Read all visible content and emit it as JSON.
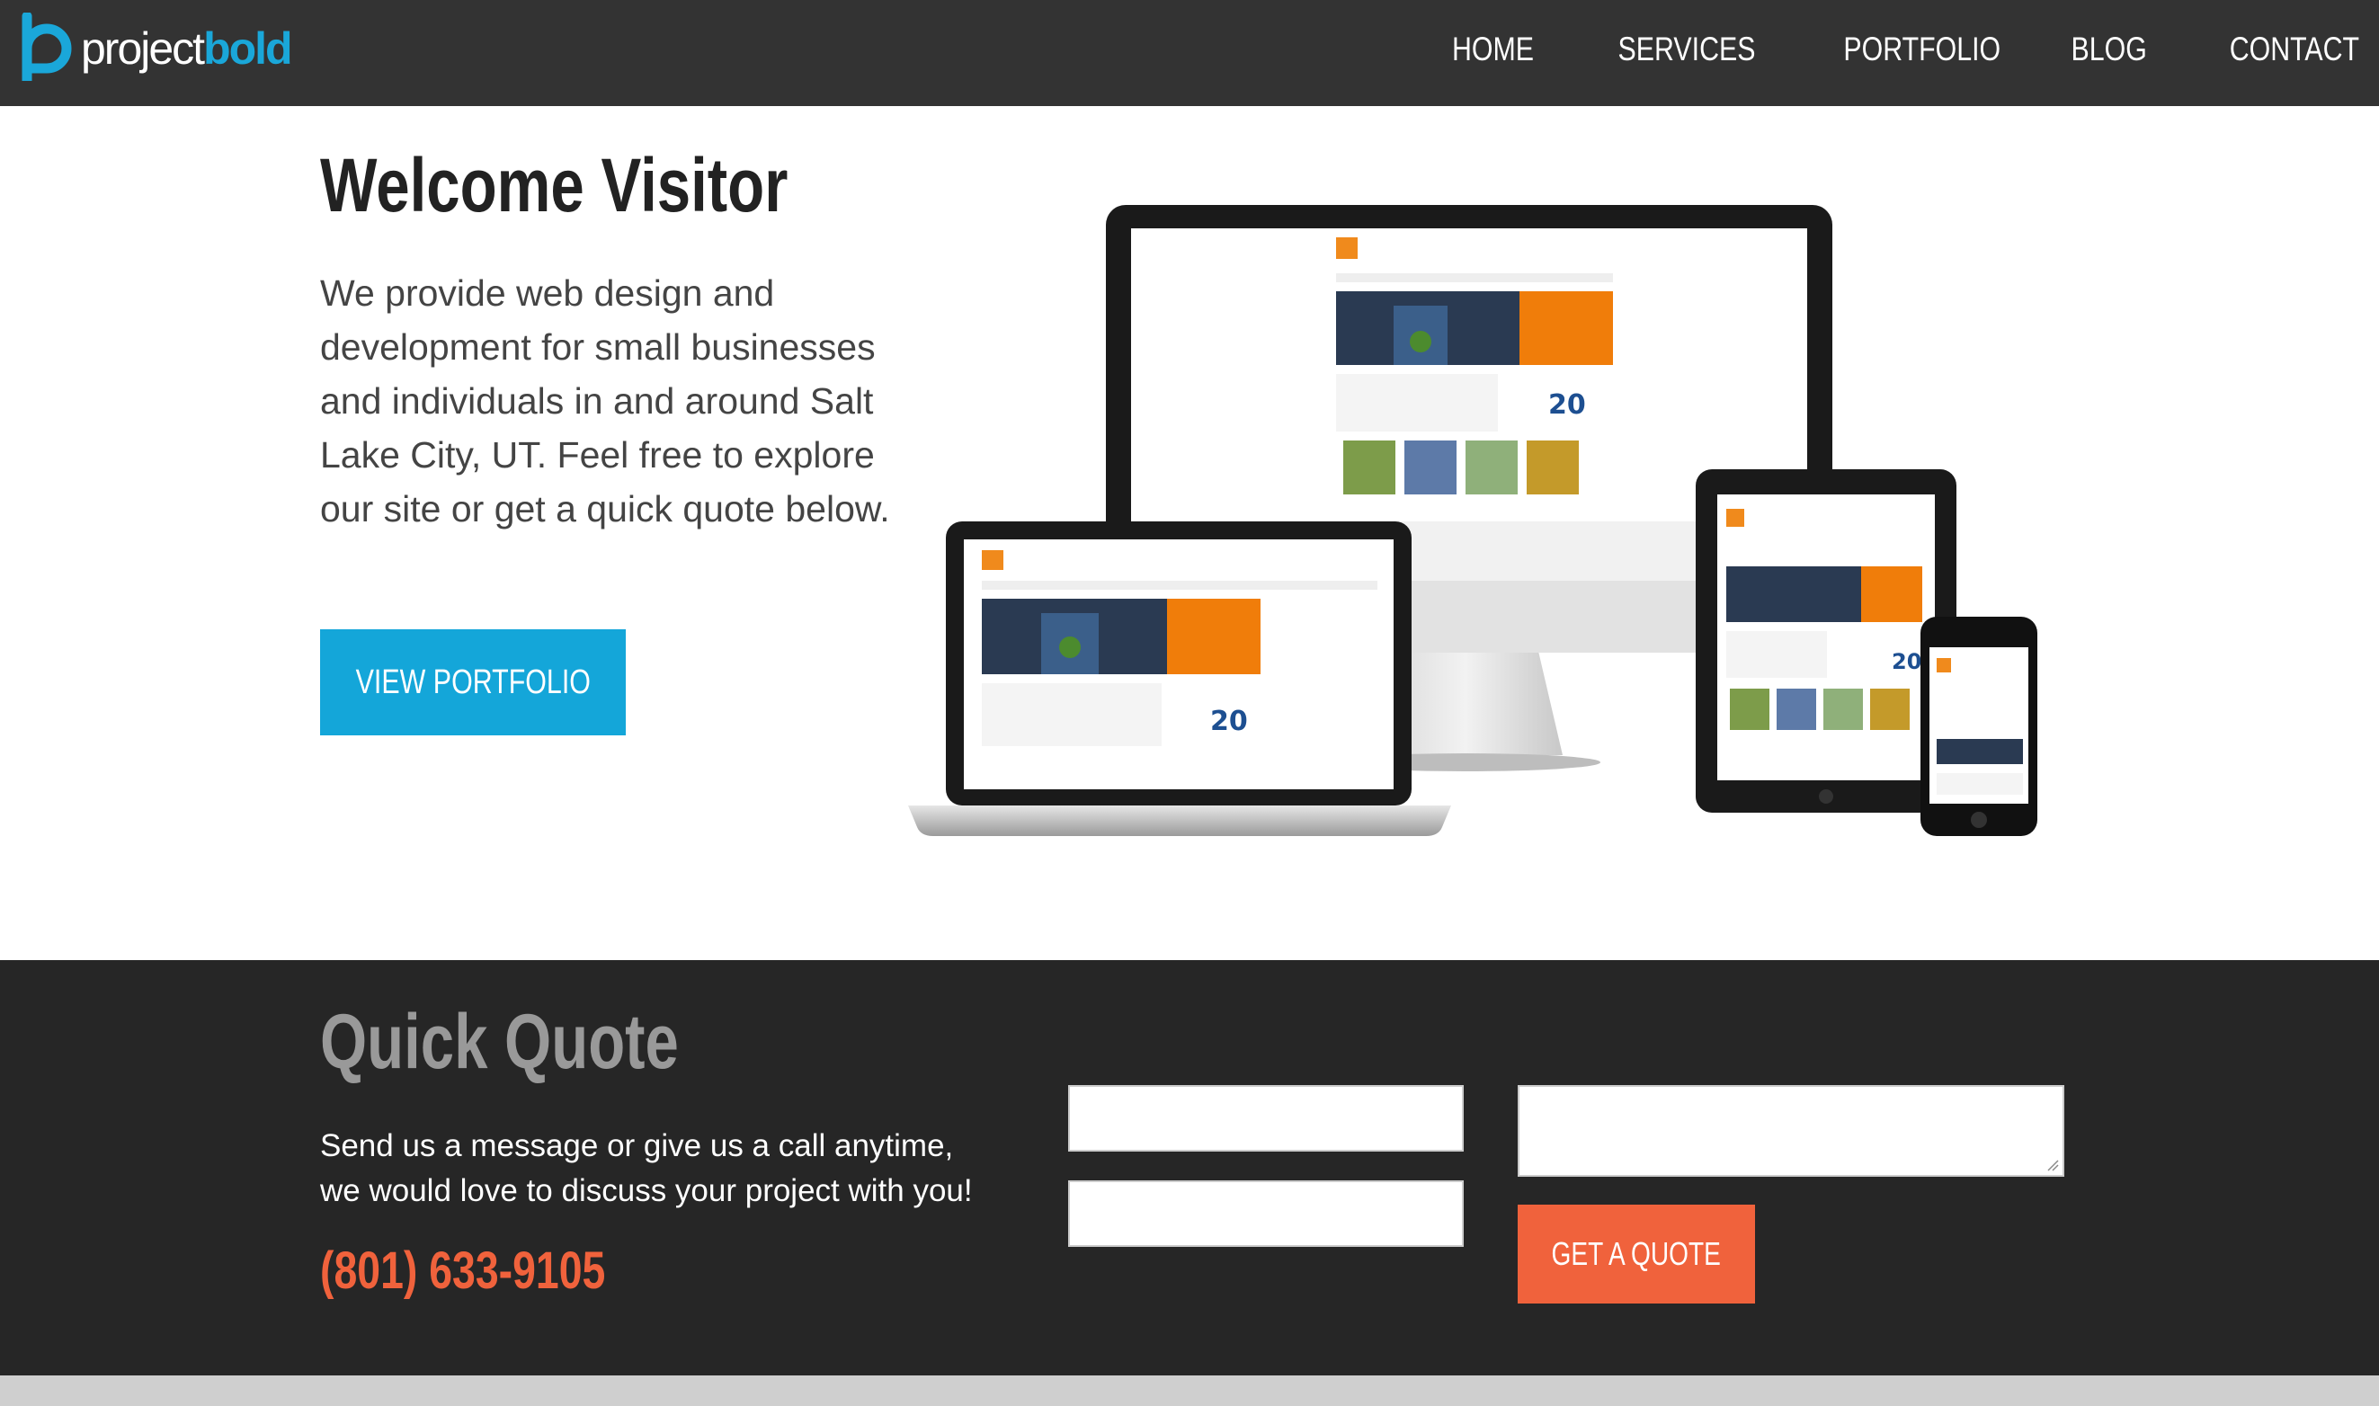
{
  "header": {
    "logo": {
      "part1": "project",
      "part2": "bold"
    },
    "nav": [
      "HOME",
      "SERVICES",
      "PORTFOLIO",
      "BLOG",
      "CONTACT"
    ]
  },
  "hero": {
    "title": "Welcome Visitor",
    "text": "We provide web design and development for small businesses and individuals in and around Salt Lake City, UT. Feel free to explore our site or get a quick quote below.",
    "button_label": "VIEW PORTFOLIO",
    "devices_icon": "responsive-devices-mockup-icon"
  },
  "quick_quote": {
    "title": "Quick Quote",
    "text": "Send us a message or give us a call anytime, we would love to discuss your project with you!",
    "phone": "(801) 633-9105",
    "button_label": "GET A QUOTE"
  },
  "colors": {
    "header_bg": "#333333",
    "accent_blue": "#14a6d9",
    "accent_orange": "#f0623c",
    "quote_bg": "#262626"
  }
}
